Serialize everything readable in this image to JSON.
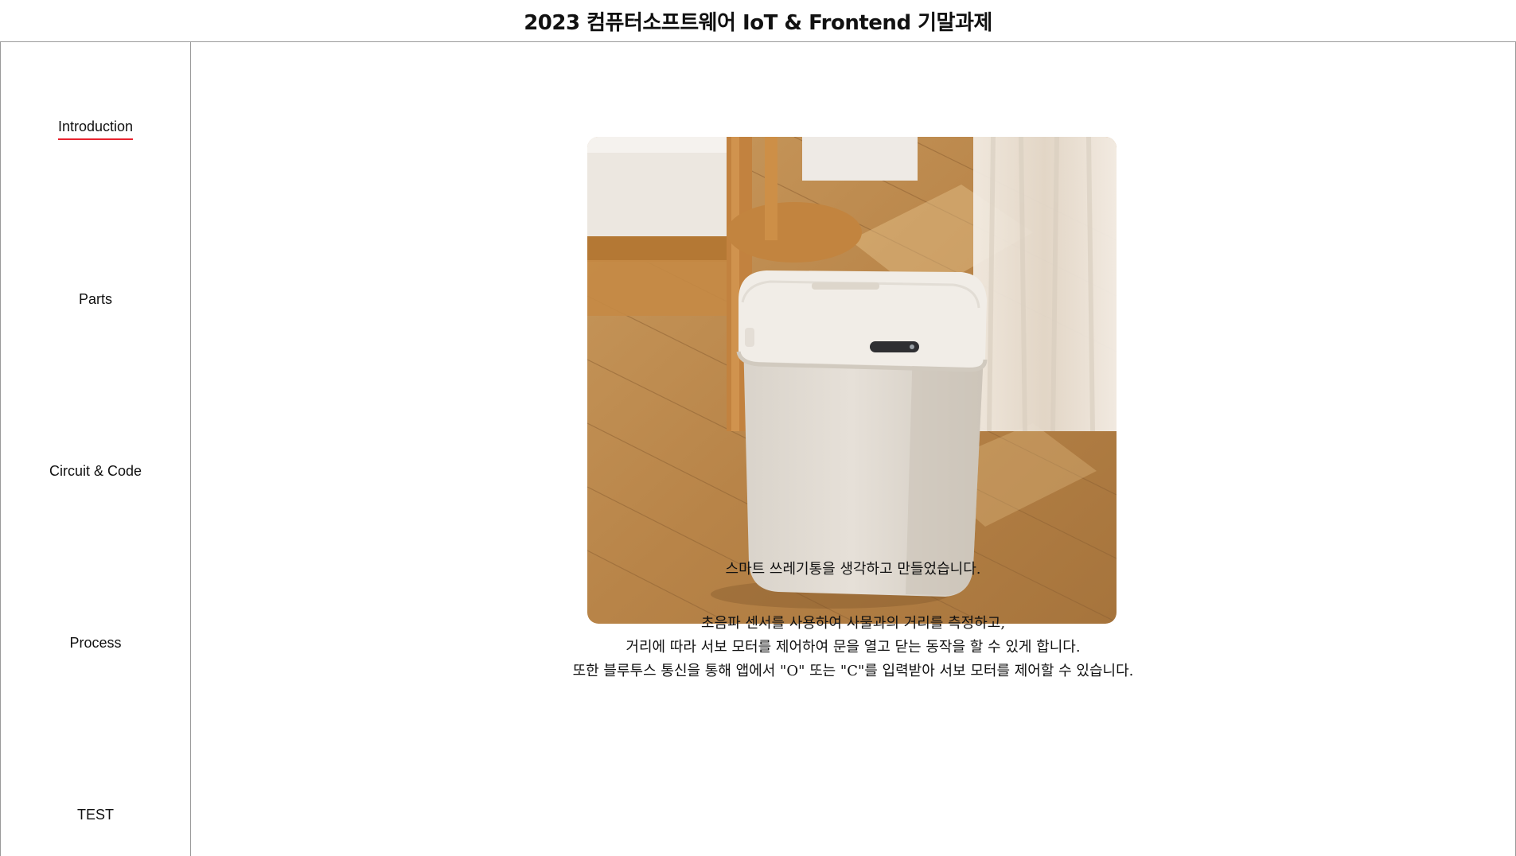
{
  "header": {
    "title": "2023 컴퓨터소프트웨어 IoT & Frontend 기말과제"
  },
  "sidebar": {
    "items": [
      {
        "label": "Introduction",
        "active": true
      },
      {
        "label": "Parts",
        "active": false
      },
      {
        "label": "Circuit & Code",
        "active": false
      },
      {
        "label": "Process",
        "active": false
      },
      {
        "label": "TEST",
        "active": false
      }
    ]
  },
  "main": {
    "image": {
      "icon": "smart-trash-can-photo"
    },
    "intro": "스마트 쓰레기통을 생각하고 만들었습니다.",
    "description": [
      "초음파 센서를 사용하여 사물과의 거리를 측정하고,",
      "거리에 따라 서보 모터를 제어하여 문을 열고 닫는 동작을 할 수 있게 합니다.",
      "또한 블루투스 통신을 통해 앱에서 \"O\" 또는 \"C\"를 입력받아 서보 모터를 제어할 수 있습니다."
    ]
  },
  "colors": {
    "accent": "#e8232f",
    "border": "#9a9a9a"
  }
}
